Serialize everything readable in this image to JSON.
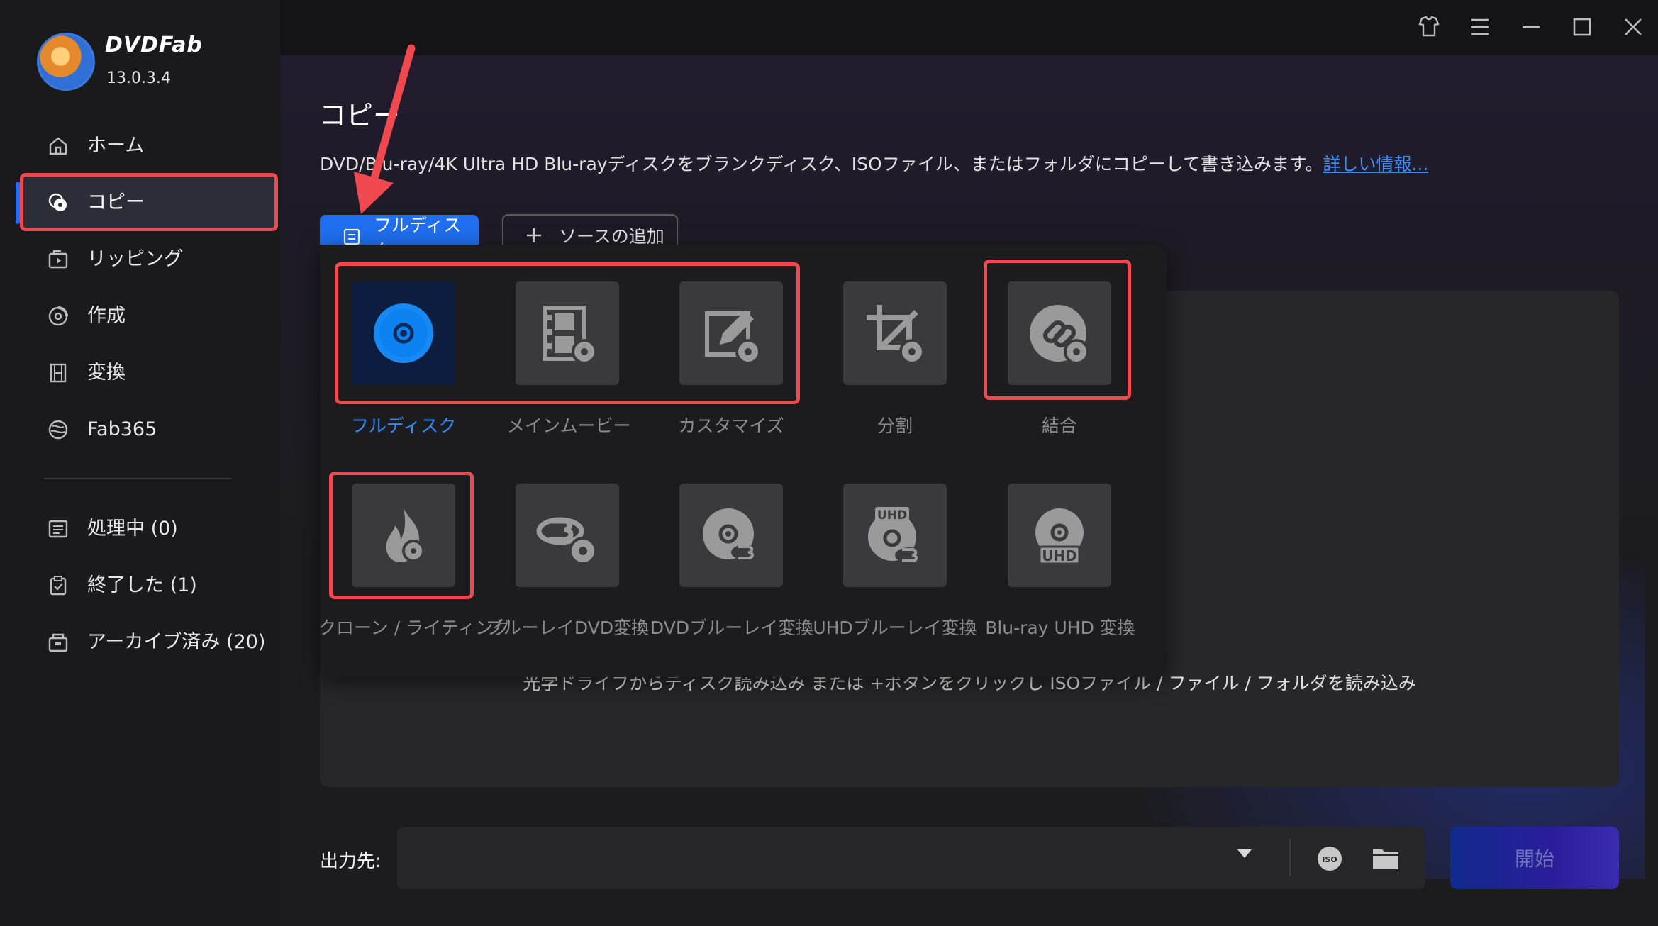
{
  "app": {
    "brand": "DVDFab",
    "version": "13.0.3.4"
  },
  "sidebar": {
    "items": [
      {
        "label": "ホーム",
        "icon": "home-icon"
      },
      {
        "label": "コピー",
        "icon": "copy-disc-icon",
        "active": true
      },
      {
        "label": "リッピング",
        "icon": "ripper-icon"
      },
      {
        "label": "作成",
        "icon": "creator-icon"
      },
      {
        "label": "変換",
        "icon": "film-icon"
      },
      {
        "label": "Fab365",
        "icon": "fab365-icon"
      }
    ],
    "queue": [
      {
        "label": "処理中 (0)",
        "icon": "task-list-icon"
      },
      {
        "label": "終了した (1)",
        "icon": "clipboard-check-icon"
      },
      {
        "label": "アーカイブ済み (20)",
        "icon": "archive-box-icon"
      }
    ]
  },
  "page": {
    "title": "コピー",
    "description": "DVD/Blu-ray/4K Ultra HD Blu-rayディスクをブランクディスク、ISOファイル、またはフォルダにコピーして書き込みます。",
    "more_link": "詳しい情報..."
  },
  "toolbar": {
    "mode_button": "フルディスク",
    "add_source": "ソースの追加"
  },
  "modes": [
    {
      "label": "フルディスク",
      "icon": "full-disc-icon",
      "selected": true
    },
    {
      "label": "メインムービー",
      "icon": "main-movie-icon"
    },
    {
      "label": "カスタマイズ",
      "icon": "customize-icon"
    },
    {
      "label": "分割",
      "icon": "split-icon"
    },
    {
      "label": "結合",
      "icon": "merge-icon"
    },
    {
      "label": "クローン / ライティング",
      "icon": "clone-burn-icon"
    },
    {
      "label": "ブルーレイDVD変換",
      "icon": "bluray-to-dvd-icon"
    },
    {
      "label": "DVDブルーレイ変換",
      "icon": "dvd-to-bluray-icon"
    },
    {
      "label": "UHDブルーレイ変換",
      "icon": "uhd-to-bluray-icon",
      "badge": "UHD"
    },
    {
      "label": "Blu-ray UHD 変換",
      "icon": "bluray-to-uhd-icon",
      "badge": "UHD"
    }
  ],
  "drop_hint": "光学ドライブからディスク読み込み または +ボタンをクリックし ISOファイル / ファイル / フォルダを読み込み",
  "output": {
    "label": "出力先:",
    "iso_text": "ISO",
    "start": "開始"
  },
  "colors": {
    "accent": "#1f6ff0",
    "highlight": "#f0484f"
  }
}
